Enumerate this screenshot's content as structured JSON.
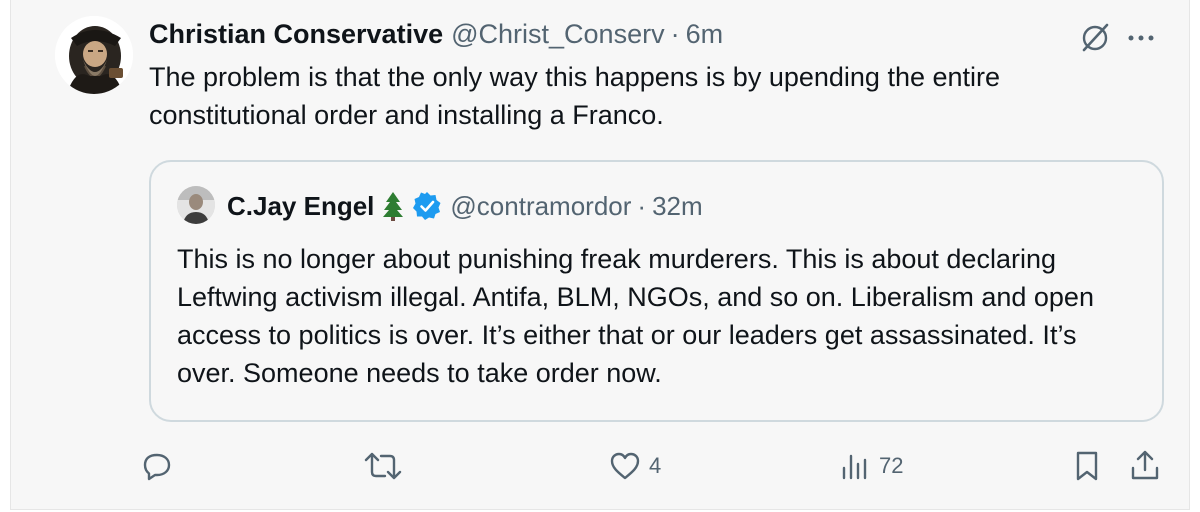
{
  "tweet": {
    "display_name": "Christian Conservative",
    "handle": "@Christ_Conserv",
    "separator": "·",
    "time": "6m",
    "text": "The problem is that the only way this happens is by upending the entire constitutional order and installing a Franco.",
    "avatar_icon": "john-knox-portrait-avatar",
    "grok_icon": "grok-icon",
    "more_icon": "more-icon"
  },
  "quote": {
    "display_name": "C.Jay Engel",
    "emoji_icon": "evergreen-tree-icon",
    "verified_icon": "verified-badge-icon",
    "handle": "@contramordor",
    "separator": "·",
    "time": "32m",
    "text": "This is no longer about punishing freak murderers. This is about declaring Leftwing activism illegal. Antifa, BLM, NGOs, and so on. Liberalism and open access to politics is over. It’s either that or our leaders get assassinated. It’s over. Someone needs to take order now."
  },
  "actions": {
    "reply_count": "",
    "retweet_count": "",
    "like_count": "4",
    "views_count": "72"
  },
  "colors": {
    "text": "#0f1419",
    "secondary": "#536471",
    "verified": "#1d9bf0",
    "border": "#cfd9de",
    "background": "#f7f7f7"
  }
}
